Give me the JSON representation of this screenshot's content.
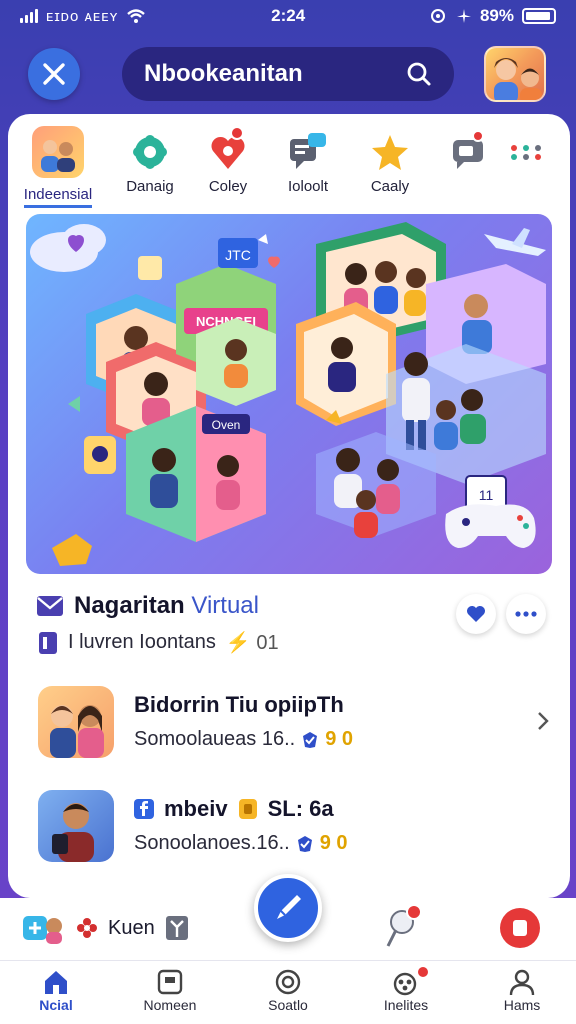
{
  "status_bar": {
    "carrier": "ᴇɪᴅᴏ ᴀᴇᴇʏ",
    "time": "2:24",
    "battery": "89%"
  },
  "header": {
    "search_text": "Nbookeanitan"
  },
  "categories": [
    {
      "label": "Indeensial",
      "icon": "people-photo-icon",
      "active": true
    },
    {
      "label": "Danaig",
      "icon": "gear-flower-icon",
      "active": false
    },
    {
      "label": "Coley",
      "icon": "heart-pin-icon",
      "active": false
    },
    {
      "label": "Ioloolt",
      "icon": "chat-bubble-icon",
      "active": false
    },
    {
      "label": "Caaly",
      "icon": "star-icon",
      "active": false
    },
    {
      "label": "",
      "icon": "video-chat-icon",
      "active": false
    },
    {
      "label": "",
      "icon": "more-dots-icon",
      "active": false
    }
  ],
  "hero": {
    "sign_text": "NCHNGEI",
    "board_text": "JTC",
    "tag_text": "Oven",
    "card_text": "11"
  },
  "feature": {
    "title": "Nagaritan",
    "title_accent": "Virtual",
    "subtitle": "I luvren Ioontans",
    "subtitle_count": "⚡ 01"
  },
  "list": [
    {
      "title": "Bidorrin Tiu opiipTh",
      "subtitle": "Somoolaueas 16..",
      "meta": "9 0"
    },
    {
      "title": "mbeiv",
      "title_badge": "SL: 6a",
      "subtitle": "Sonoolanoes.16..",
      "meta": "9 0"
    }
  ],
  "action_bar": {
    "label": "Kuen"
  },
  "tabs": [
    {
      "label": "Ncial",
      "icon": "home-icon",
      "active": true
    },
    {
      "label": "Nomeen",
      "icon": "square-icon",
      "active": false
    },
    {
      "label": "Soatlo",
      "icon": "circle-icon",
      "active": false
    },
    {
      "label": "Inelites",
      "icon": "group-icon",
      "active": false
    },
    {
      "label": "Hams",
      "icon": "person-icon",
      "active": false
    }
  ],
  "colors": {
    "accent": "#2f63e0",
    "brand_dark": "#2a2680",
    "alert": "#e53838"
  }
}
